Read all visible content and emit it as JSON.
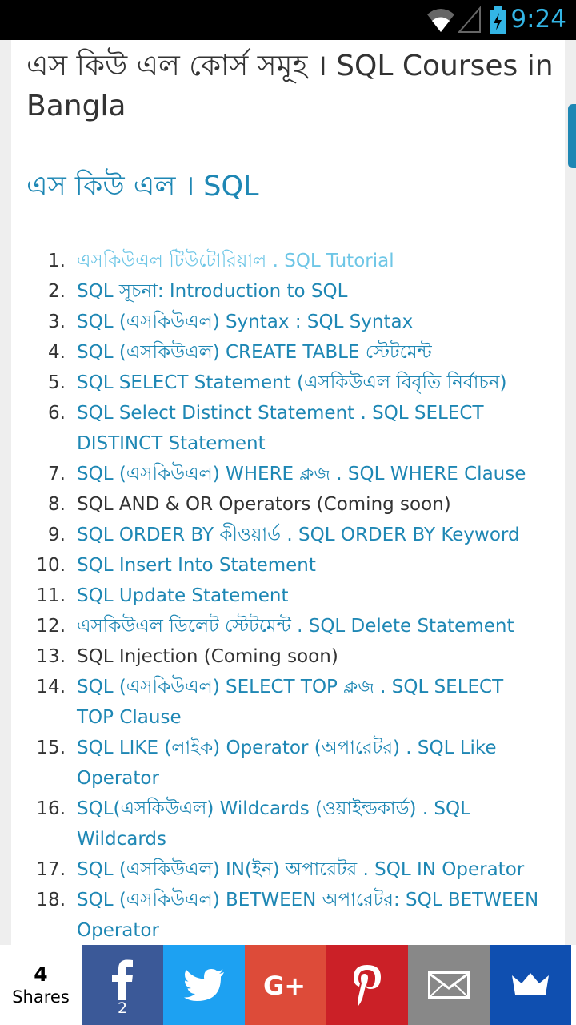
{
  "status": {
    "time": "9:24"
  },
  "page": {
    "title": "এস কিউ এল কোর্স সমূহ । SQL Courses in Bangla",
    "section_heading": "এস কিউ এল । SQL",
    "courses": [
      {
        "num": "1.",
        "label": "এসকিউএল টিউটোরিয়াল . SQL Tutorial",
        "style": "visited"
      },
      {
        "num": "2.",
        "label": "SQL সূচনা: Introduction to SQL",
        "style": "link"
      },
      {
        "num": "3.",
        "label": "SQL (এসকিউএল) Syntax : SQL Syntax",
        "style": "link"
      },
      {
        "num": "4.",
        "label": "SQL (এসকিউএল) CREATE TABLE স্টেটমেন্ট",
        "style": "link"
      },
      {
        "num": "5.",
        "label": "SQL SELECT Statement (এসকিউএল বিবৃতি নির্বাচন)",
        "style": "link"
      },
      {
        "num": "6.",
        "label": "SQL Select Distinct Statement . SQL SELECT DISTINCT Statement",
        "style": "link"
      },
      {
        "num": "7.",
        "label": "SQL (এসকিউএল) WHERE ক্লজ . SQL WHERE Clause",
        "style": "link"
      },
      {
        "num": "8.",
        "label": "SQL AND & OR Operators (Coming soon)",
        "style": "plain"
      },
      {
        "num": "9.",
        "label": "SQL ORDER BY কীওয়ার্ড . SQL ORDER BY Keyword",
        "style": "link"
      },
      {
        "num": "10.",
        "label": "SQL Insert Into Statement",
        "style": "link"
      },
      {
        "num": "11.",
        "label": "SQL Update Statement",
        "style": "link"
      },
      {
        "num": "12.",
        "label": "এসকিউএল ডিলেট স্টেটমেন্ট . SQL Delete Statement",
        "style": "link"
      },
      {
        "num": "13.",
        "label": "SQL Injection (Coming soon)",
        "style": "plain"
      },
      {
        "num": "14.",
        "label": "SQL (এসকিউএল) SELECT TOP ক্লজ . SQL SELECT TOP Clause",
        "style": "link"
      },
      {
        "num": "15.",
        "label": "SQL LIKE (লাইক) Operator (অপারেটর) . SQL Like Operator",
        "style": "link"
      },
      {
        "num": "16.",
        "label": "SQL(এসকিউএল) Wildcards (ওয়াইল্ডকার্ড) . SQL Wildcards",
        "style": "link"
      },
      {
        "num": "17.",
        "label": "SQL (এসকিউএল) IN(ইন) অপারেটর . SQL IN Operator",
        "style": "link"
      },
      {
        "num": "18.",
        "label": "SQL (এসকিউএল) BETWEEN অপারেটর: SQL BETWEEN Operator",
        "style": "link"
      }
    ]
  },
  "share": {
    "total": "4",
    "total_label": "Shares",
    "facebook_count": "2",
    "buttons": [
      {
        "name": "facebook",
        "icon": "facebook-icon",
        "color": "#3b5998"
      },
      {
        "name": "twitter",
        "icon": "twitter-icon",
        "color": "#1da1f2"
      },
      {
        "name": "google-plus",
        "icon": "google-plus-icon",
        "color": "#dd4b39"
      },
      {
        "name": "pinterest",
        "icon": "pinterest-icon",
        "color": "#cb2027"
      },
      {
        "name": "email",
        "icon": "email-icon",
        "color": "#888888"
      },
      {
        "name": "more",
        "icon": "crown-icon",
        "color": "#0f4fb0"
      }
    ]
  },
  "colors": {
    "link": "#1e87b4",
    "visited_link": "#6ec6e6",
    "text": "#333333",
    "status_accent": "#33b5e5"
  }
}
